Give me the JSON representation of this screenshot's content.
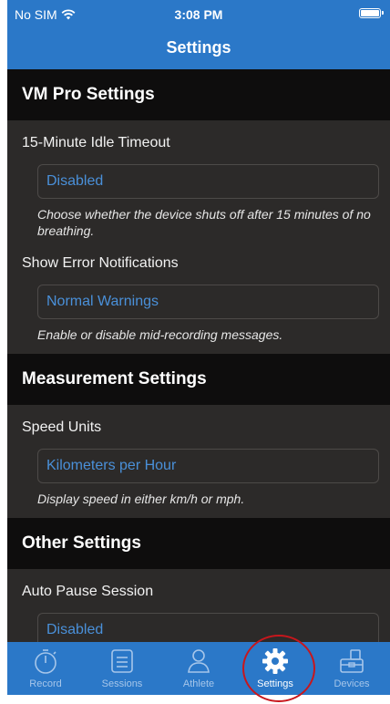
{
  "status_bar": {
    "carrier": "No SIM",
    "time": "3:08 PM"
  },
  "nav": {
    "title": "Settings"
  },
  "sections": [
    {
      "title": "VM Pro Settings",
      "settings": [
        {
          "label": "15-Minute Idle Timeout",
          "value": "Disabled",
          "hint": "Choose whether the device shuts off after 15 minutes of no breathing."
        },
        {
          "label": "Show Error Notifications",
          "value": "Normal Warnings",
          "hint": "Enable or disable mid-recording messages."
        }
      ]
    },
    {
      "title": "Measurement Settings",
      "settings": [
        {
          "label": "Speed Units",
          "value": "Kilometers per Hour",
          "hint": "Display speed in either km/h or mph."
        }
      ]
    },
    {
      "title": "Other Settings",
      "settings": [
        {
          "label": "Auto Pause Session",
          "value": "Disabled"
        }
      ]
    }
  ],
  "tabs": [
    {
      "label": "Record",
      "icon": "record-timer-icon"
    },
    {
      "label": "Sessions",
      "icon": "sessions-list-icon"
    },
    {
      "label": "Athlete",
      "icon": "athlete-person-icon"
    },
    {
      "label": "Settings",
      "icon": "gear-icon",
      "active": true
    },
    {
      "label": "Devices",
      "icon": "devices-icon"
    }
  ],
  "colors": {
    "accent": "#2b78c8",
    "background": "#2c2a29",
    "section_header": "#0e0d0d",
    "value_text": "#4a90d9",
    "highlight_circle": "#c8161c"
  }
}
